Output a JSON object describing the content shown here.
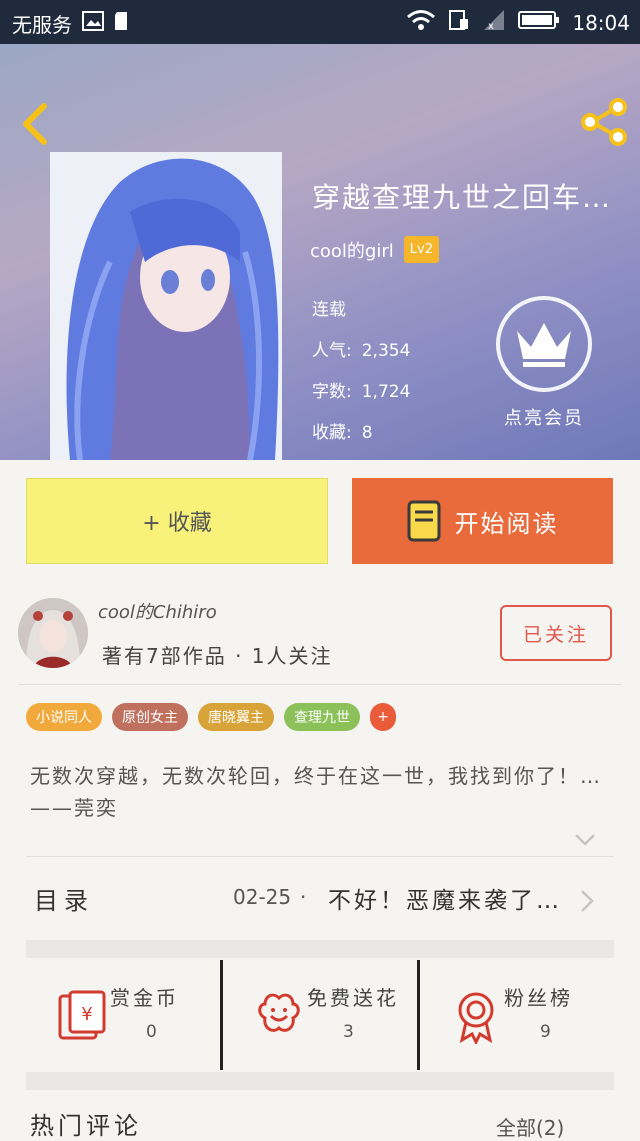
{
  "status_bar": {
    "carrier": "无服务",
    "time": "18:04"
  },
  "book": {
    "title": "穿越查理九世之回车…",
    "author": "cool的girl",
    "level": "Lv2",
    "status": "连载",
    "stats": [
      {
        "label": "人气:",
        "value": "2,354"
      },
      {
        "label": "字数:",
        "value": "1,724"
      },
      {
        "label": "收藏:",
        "value": "8"
      }
    ]
  },
  "vip": {
    "label": "点亮会员"
  },
  "actions": {
    "collect": "+ 收藏",
    "read": "开始阅读"
  },
  "writer": {
    "name": "cool的Chihiro",
    "info": "著有7部作品 · 1人关注",
    "follow": "已关注"
  },
  "tags": [
    {
      "label": "小说同人",
      "color": "#f2a93b"
    },
    {
      "label": "原创女主",
      "color": "#c0705f"
    },
    {
      "label": "唐晓翼主",
      "color": "#d8a43a"
    },
    {
      "label": "查理九世",
      "color": "#8cc15a"
    }
  ],
  "tag_more": "+",
  "synopsis": "无数次穿越，无数次轮回，终于在这一世，我找到你了！…——莞奕",
  "toc": {
    "label": "目录",
    "date": "02-25",
    "separator": "·",
    "chapter": "不好！恶魔来袭了…"
  },
  "rewards": [
    {
      "title": "赏金币",
      "count": "0",
      "icon": "red-envelope-icon"
    },
    {
      "title": "免费送花",
      "count": "3",
      "icon": "flower-icon"
    },
    {
      "title": "粉丝榜",
      "count": "9",
      "icon": "medal-icon"
    }
  ],
  "comments": {
    "title": "热门评论",
    "all": "全部(2)"
  },
  "colors": {
    "accent_orange": "#e96a3b",
    "collect_yellow": "#f8f27a",
    "follow_red": "#e2564b"
  }
}
